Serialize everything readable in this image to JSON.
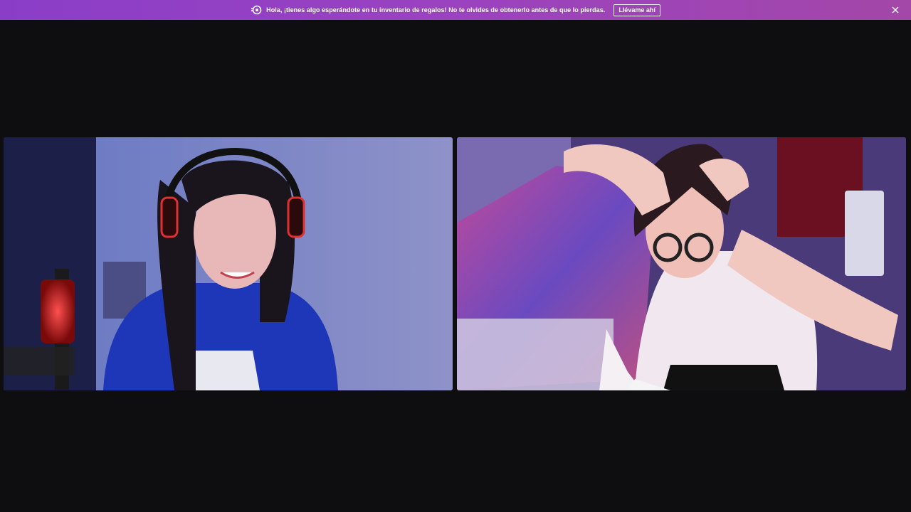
{
  "banner": {
    "message": "Hola, ¡tienes algo esperándote en tu inventario de regalos! No te olvides de obtenerlo antes de que lo pierdas.",
    "button_label": "Llévame ahí",
    "icon": "gift-icon",
    "close_icon": "close-icon",
    "background_color": "#9b42c0"
  },
  "videos": [
    {
      "name": "participant-left-video"
    },
    {
      "name": "participant-right-video"
    }
  ]
}
